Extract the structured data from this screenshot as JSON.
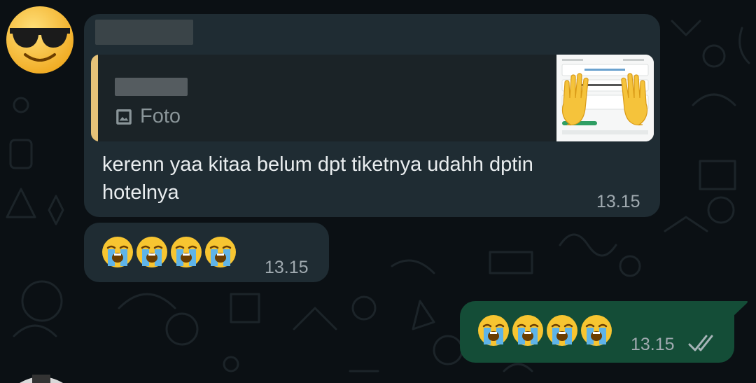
{
  "chat": {
    "messages": [
      {
        "direction": "incoming",
        "quote": {
          "media_label": "Foto",
          "media_icon": "photo-icon"
        },
        "text": "kerenn yaa kitaa belum dpt tiketnya udahh dptin hotelnya",
        "time": "13.15"
      },
      {
        "direction": "incoming",
        "emoji": [
          "😭",
          "😭",
          "😭",
          "😭"
        ],
        "time": "13.15"
      },
      {
        "direction": "outgoing",
        "emoji": [
          "😭",
          "😭",
          "😭",
          "😭"
        ],
        "time": "13.15",
        "status_icon": "double-check-icon"
      }
    ]
  },
  "colors": {
    "background": "#0b1014",
    "incoming_bubble": "#1f2c33",
    "outgoing_bubble": "#144d37",
    "quote_accent": "#e6c278",
    "text": "#e9edef",
    "meta": "#a0aab0"
  }
}
